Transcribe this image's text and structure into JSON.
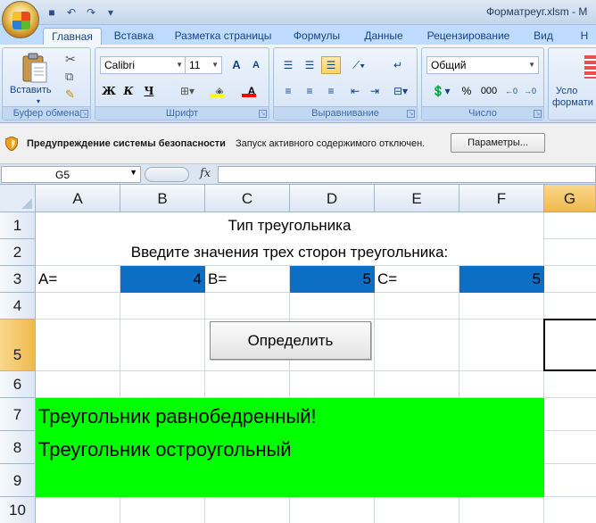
{
  "window": {
    "title": "Форматреуг.xlsm - M"
  },
  "ribbon": {
    "tabs": [
      "Главная",
      "Вставка",
      "Разметка страницы",
      "Формулы",
      "Данные",
      "Рецензирование",
      "Вид",
      "Н"
    ],
    "active_tab": "Главная",
    "clipboard": {
      "paste_label": "Вставить",
      "group_label": "Буфер обмена"
    },
    "font": {
      "name": "Calibri",
      "size": "11",
      "group_label": "Шрифт",
      "bold": "Ж",
      "italic": "К",
      "underline": "Ч",
      "grow": "A",
      "shrink": "A"
    },
    "alignment": {
      "group_label": "Выравнивание"
    },
    "number": {
      "format": "Общий",
      "group_label": "Число",
      "percent": "%",
      "thousands": "000"
    },
    "styles": {
      "partial_label_1": "Усло",
      "partial_label_2": "формати"
    }
  },
  "security_bar": {
    "title": "Предупреждение системы безопасности",
    "message": "Запуск активного содержимого отключен.",
    "button": "Параметры..."
  },
  "formula_bar": {
    "name_box": "G5",
    "fx": "fx",
    "value": ""
  },
  "grid": {
    "columns": [
      "A",
      "B",
      "C",
      "D",
      "E",
      "F",
      "G"
    ],
    "rows": [
      "1",
      "2",
      "3",
      "4",
      "5",
      "6",
      "7",
      "8",
      "9",
      "10"
    ],
    "selected_cell": "G5"
  },
  "sheet": {
    "title": "Тип треугольника",
    "prompt": "Введите значения трех сторон треугольника:",
    "label_a": "A=",
    "value_a": "4",
    "label_b": "B=",
    "value_b": "5",
    "label_c": "C=",
    "value_c": "5",
    "button": "Определить",
    "result_1": "Треугольник равнобедренный!",
    "result_2": "Треугольник остроугольный"
  },
  "colors": {
    "input_fill": "#0d6fc4",
    "result_fill": "#00ff00",
    "selected_header": "#f1b94c"
  }
}
